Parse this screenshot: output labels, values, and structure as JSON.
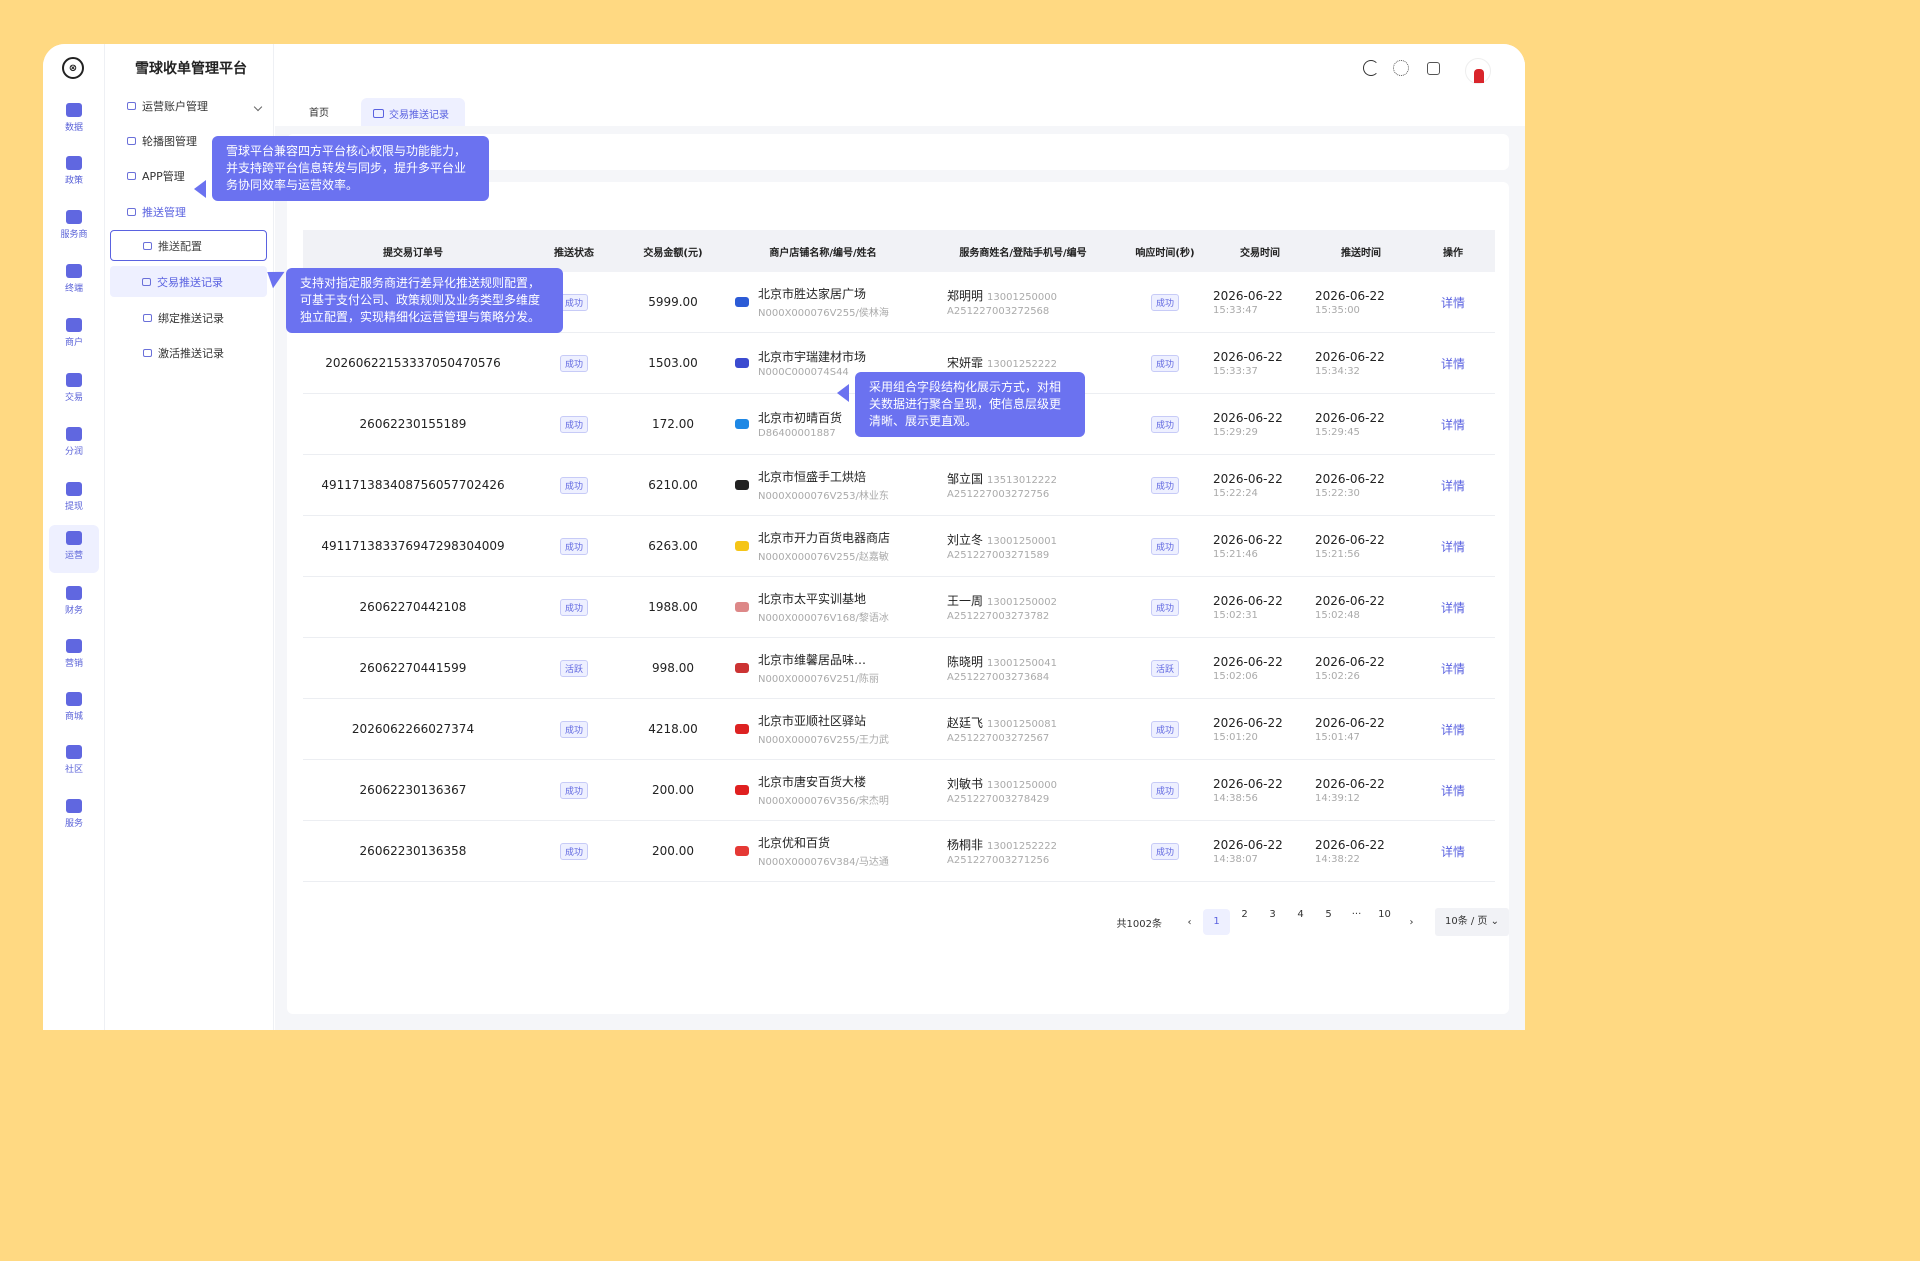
{
  "app": {
    "title": "雪球收单管理平台"
  },
  "rail": [
    {
      "label": "数据"
    },
    {
      "label": "政策"
    },
    {
      "label": "服务商"
    },
    {
      "label": "终端"
    },
    {
      "label": "商户"
    },
    {
      "label": "交易"
    },
    {
      "label": "分润"
    },
    {
      "label": "提现"
    },
    {
      "label": "运营"
    },
    {
      "label": "财务"
    },
    {
      "label": "营销"
    },
    {
      "label": "商城"
    },
    {
      "label": "社区"
    },
    {
      "label": "服务"
    }
  ],
  "menu": {
    "ops": "运营账户管理",
    "carousel": "轮播图管理",
    "app": "APP管理",
    "push": "推送管理",
    "push_config": "推送配置",
    "push_records": "交易推送记录",
    "bind_records": "绑定推送记录",
    "activate_records": "激活推送记录"
  },
  "tabs": {
    "home": "首页",
    "current": "交易推送记录"
  },
  "table": {
    "headers": [
      "提交易订单号",
      "推送状态",
      "交易金额(元)",
      "商户店铺名称/编号/姓名",
      "服务商姓名/登陆手机号/编号",
      "响应时间(秒)",
      "交易时间",
      "推送时间",
      "操作"
    ],
    "rows": [
      {
        "order": "",
        "status": "成功",
        "amount": "5999.00",
        "m_name": "北京市胜达家居广场",
        "m_sub": "N000X000076V255/侯林海",
        "s_name": "郑明明",
        "s_phone": "13001250000",
        "s_code": "A251227003272568",
        "resp": "成功",
        "t_date": "2026-06-22",
        "t_time": "15:33:47",
        "p_date": "2026-06-22",
        "p_time": "15:35:00",
        "op": "详情"
      },
      {
        "order": "20260622153337050470576",
        "status": "成功",
        "amount": "1503.00",
        "m_name": "北京市宇瑞建材市场",
        "m_sub": "N000C000074S44",
        "s_name": "宋妍霏",
        "s_phone": "13001252222",
        "s_code": "",
        "resp": "成功",
        "t_date": "2026-06-22",
        "t_time": "15:33:37",
        "p_date": "2026-06-22",
        "p_time": "15:34:32",
        "op": "详情"
      },
      {
        "order": "26062230155189",
        "status": "成功",
        "amount": "172.00",
        "m_name": "北京市初晴百货",
        "m_sub": "D86400001887",
        "s_name": "",
        "s_phone": "",
        "s_code": "",
        "resp": "成功",
        "t_date": "2026-06-22",
        "t_time": "15:29:29",
        "p_date": "2026-06-22",
        "p_time": "15:29:45",
        "op": "详情"
      },
      {
        "order": "49117138340875605770242​6",
        "status": "成功",
        "amount": "6210.00",
        "m_name": "北京市恒盛手工烘焙",
        "m_sub": "N000X000076V253/林业东",
        "s_name": "邹立国",
        "s_phone": "13513012222",
        "s_code": "A251227003272756",
        "resp": "成功",
        "t_date": "2026-06-22",
        "t_time": "15:22:24",
        "p_date": "2026-06-22",
        "p_time": "15:22:30",
        "op": "详情"
      },
      {
        "order": "491171383376947298304009",
        "status": "成功",
        "amount": "6263.00",
        "m_name": "北京市开力百货电器商店",
        "m_sub": "N000X000076V255/赵嘉敏",
        "s_name": "刘立冬",
        "s_phone": "13001250001",
        "s_code": "A251227003271589",
        "resp": "成功",
        "t_date": "2026-06-22",
        "t_time": "15:21:46",
        "p_date": "2026-06-22",
        "p_time": "15:21:56",
        "op": "详情"
      },
      {
        "order": "26062270442108",
        "status": "成功",
        "amount": "1988.00",
        "m_name": "北京市太平实训基地",
        "m_sub": "N000X000076V168/黎语冰",
        "s_name": "王一周",
        "s_phone": "13001250002",
        "s_code": "A251227003273782",
        "resp": "成功",
        "t_date": "2026-06-22",
        "t_time": "15:02:31",
        "p_date": "2026-06-22",
        "p_time": "15:02:48",
        "op": "详情"
      },
      {
        "order": "26062270441599",
        "status": "活跃",
        "amount": "998.00",
        "m_name": "北京市维馨居品味…",
        "m_sub": "N000X000076V251/陈丽",
        "s_name": "陈晓明",
        "s_phone": "13001250041",
        "s_code": "A251227003273684",
        "resp": "活跃",
        "t_date": "2026-06-22",
        "t_time": "15:02:06",
        "p_date": "2026-06-22",
        "p_time": "15:02:26",
        "op": "详情"
      },
      {
        "order": "2026062266027374",
        "status": "成功",
        "amount": "4218.00",
        "m_name": "北京市亚顺社区驿站",
        "m_sub": "N000X000076V255/王力武",
        "s_name": "赵廷飞",
        "s_phone": "13001250081",
        "s_code": "A251227003272567",
        "resp": "成功",
        "t_date": "2026-06-22",
        "t_time": "15:01:20",
        "p_date": "2026-06-22",
        "p_time": "15:01:47",
        "op": "详情"
      },
      {
        "order": "26062230136367",
        "status": "成功",
        "amount": "200.00",
        "m_name": "北京市唐安百货大楼",
        "m_sub": "N000X000076V356/宋杰明",
        "s_name": "刘敏书",
        "s_phone": "13001250000",
        "s_code": "A251227003278429",
        "resp": "成功",
        "t_date": "2026-06-22",
        "t_time": "14:38:56",
        "p_date": "2026-06-22",
        "p_time": "14:39:12",
        "op": "详情"
      },
      {
        "order": "26062230136358",
        "status": "成功",
        "amount": "200.00",
        "m_name": "北京优和百货",
        "m_sub": "N000X000076V384/马达通",
        "s_name": "杨桐非",
        "s_phone": "13001252222",
        "s_code": "A251227003271256",
        "resp": "成功",
        "t_date": "2026-06-22",
        "t_time": "14:38:07",
        "p_date": "2026-06-22",
        "p_time": "14:38:22",
        "op": "详情"
      }
    ]
  },
  "pager": {
    "total": "共1002条",
    "prev": "‹",
    "pages": [
      "1",
      "2",
      "3",
      "4",
      "5",
      "···",
      "10"
    ],
    "next": "›",
    "size": "10条 / 页"
  },
  "tooltips": {
    "t1": "雪球平台兼容四方平台核心权限与功能能力，并支持跨平台信息转发与同步，提升多平台业务协同效率与运营效率。",
    "t2": "支持对指定服务商进行差异化推送规则配置，可基于支付公司、政策规则及业务类型多维度独立配置，实现精细化运营管理与策略分发。",
    "t3": "采用组合字段结构化展示方式，对相关数据进行聚合呈现，使信息层级更清晰、展示更直观。"
  },
  "colors": {
    "accent": "#5a62e0",
    "tooltip": "#6b72f0",
    "page_bg": "#ffd982"
  }
}
